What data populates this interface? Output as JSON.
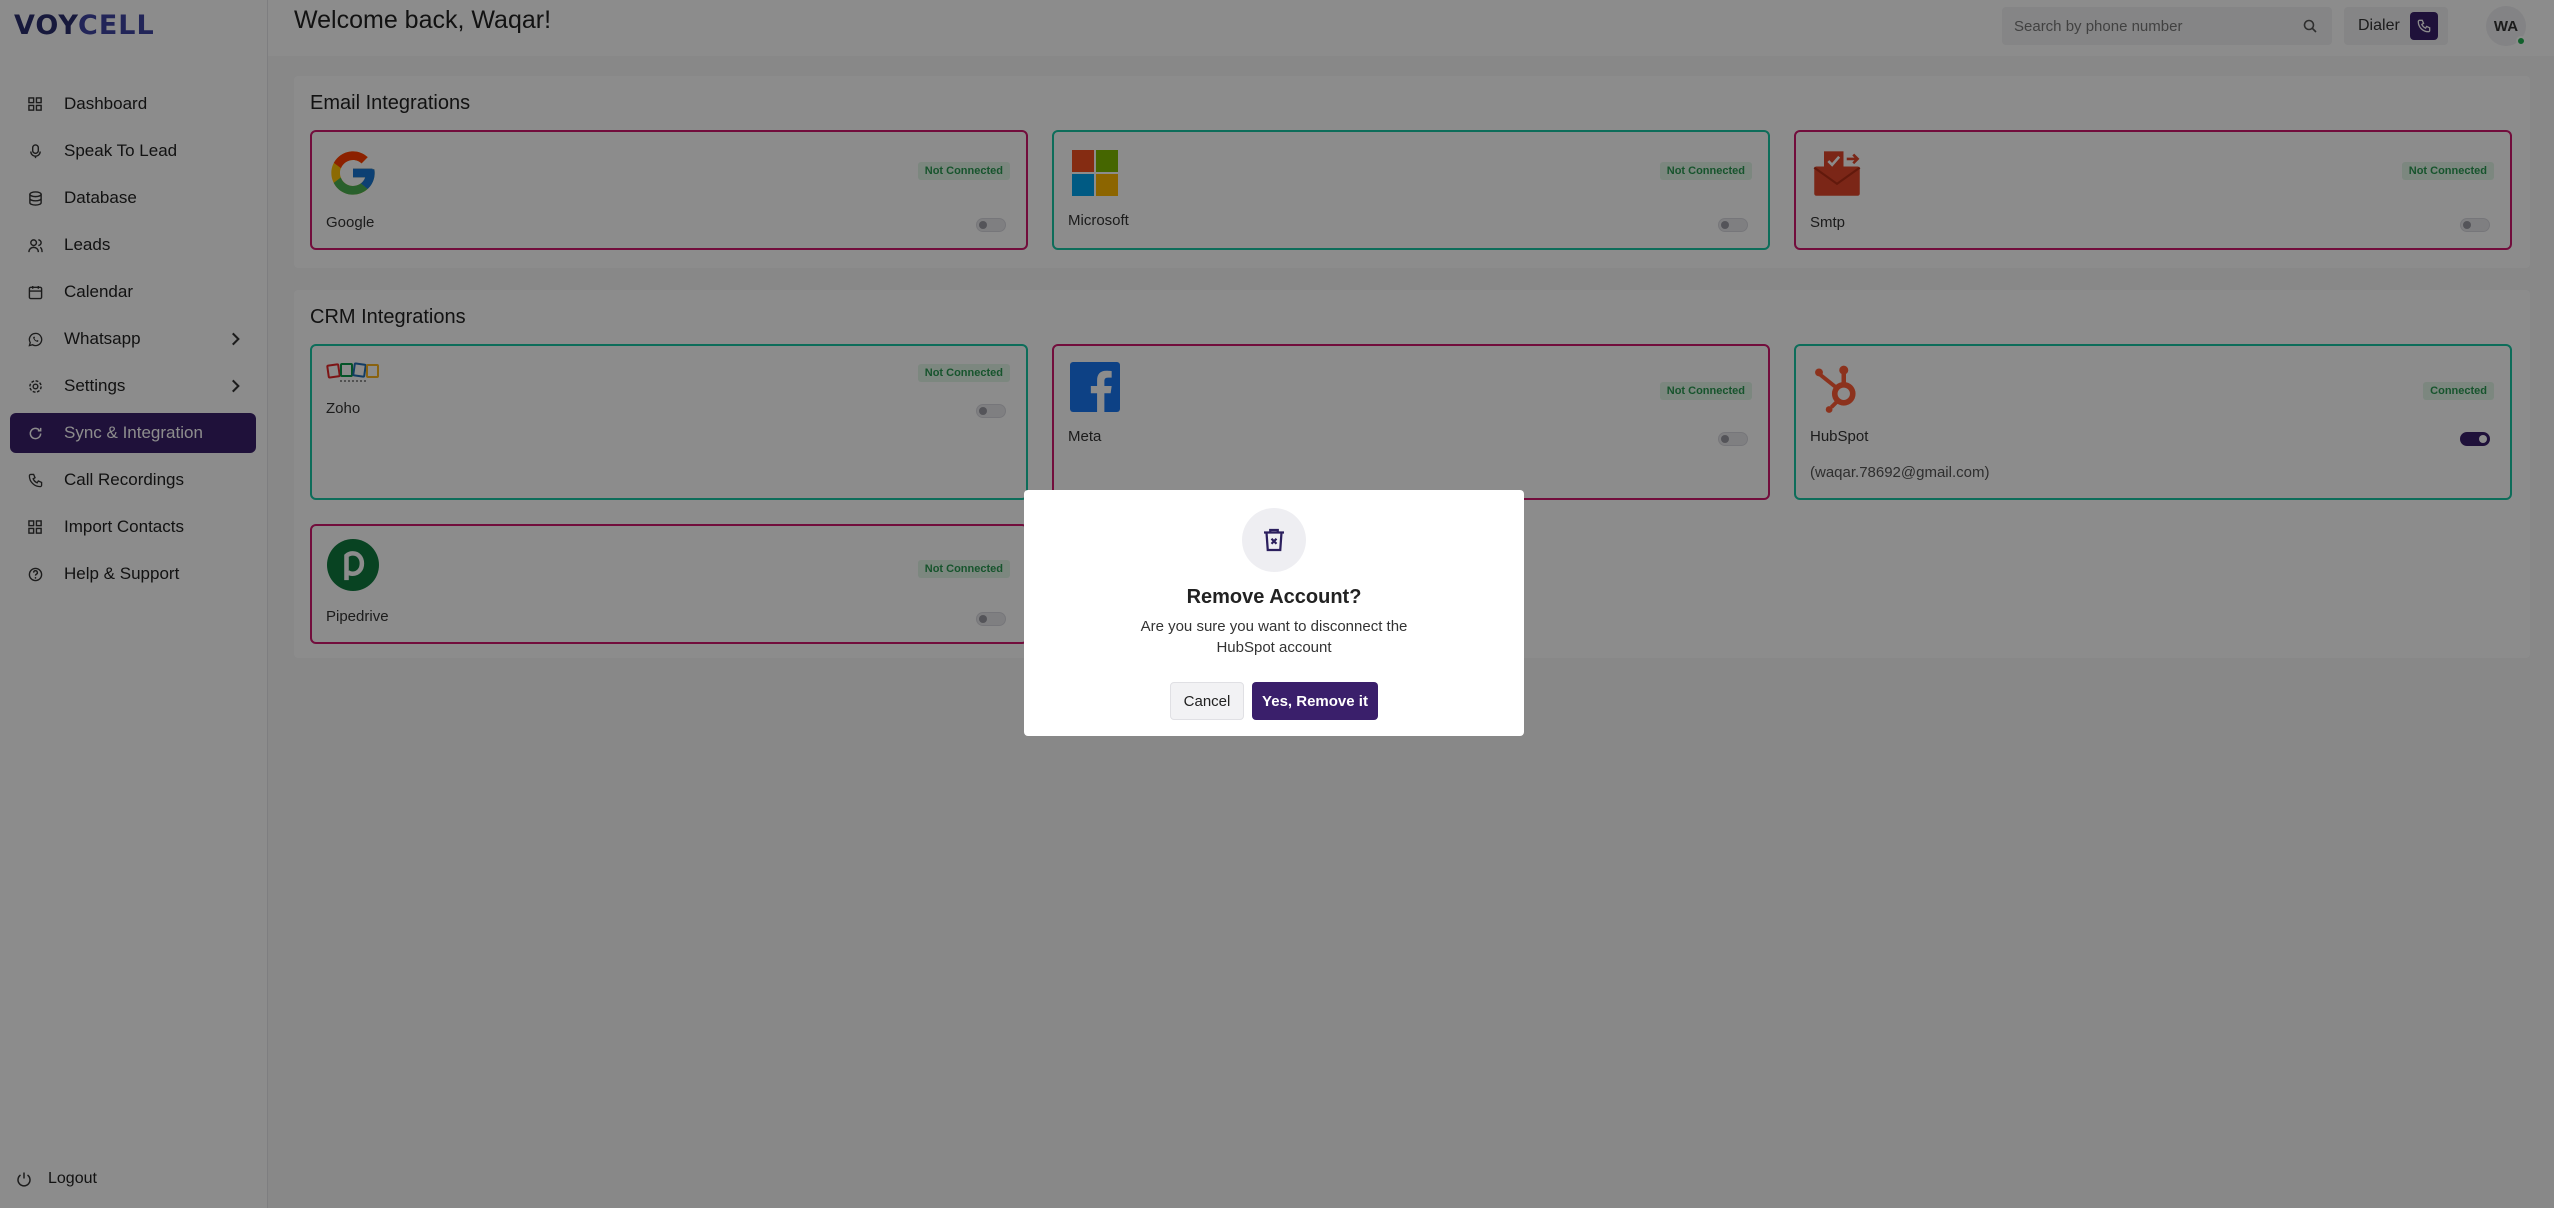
{
  "brand": {
    "part1": "VOY",
    "part2": "CELL"
  },
  "sidebar": {
    "items": [
      {
        "label": "Dashboard",
        "icon": "grid-icon"
      },
      {
        "label": "Speak To Lead",
        "icon": "mic-icon"
      },
      {
        "label": "Database",
        "icon": "database-icon"
      },
      {
        "label": "Leads",
        "icon": "users-icon"
      },
      {
        "label": "Calendar",
        "icon": "calendar-icon"
      },
      {
        "label": "Whatsapp",
        "icon": "whatsapp-icon"
      },
      {
        "label": "Settings",
        "icon": "gear-icon"
      },
      {
        "label": "Sync & Integration",
        "icon": "sync-icon"
      },
      {
        "label": "Call Recordings",
        "icon": "phone-icon"
      },
      {
        "label": "Import Contacts",
        "icon": "grid-icon"
      },
      {
        "label": "Help & Support",
        "icon": "help-icon"
      }
    ],
    "active": "Sync & Integration",
    "logout_label": "Logout"
  },
  "header": {
    "welcome": "Welcome back, Waqar!",
    "search_placeholder": "Search by phone number",
    "dialer_label": "Dialer",
    "avatar_initials": "WA"
  },
  "email_integrations": {
    "title": "Email Integrations",
    "cards": [
      {
        "name": "Google",
        "status": "Not Connected"
      },
      {
        "name": "Microsoft",
        "status": "Not Connected"
      },
      {
        "name": "Smtp",
        "status": "Not Connected"
      }
    ]
  },
  "crm_integrations": {
    "title": "CRM Integrations",
    "cards": [
      {
        "name": "Zoho",
        "status": "Not Connected"
      },
      {
        "name": "Meta",
        "status": "Not Connected"
      },
      {
        "name": "HubSpot",
        "status": "Connected",
        "email": "(waqar.78692@gmail.com)"
      },
      {
        "name": "Pipedrive",
        "status": "Not Connected"
      }
    ]
  },
  "modal": {
    "title": "Remove Account?",
    "body": "Are you sure you want to disconnect the HubSpot account",
    "cancel_label": "Cancel",
    "confirm_label": "Yes, Remove it"
  },
  "colors": {
    "accent": "#3a1f6b",
    "card_border_pink": "#d0186e",
    "card_border_teal": "#19c6a4",
    "connected_green": "#2a9a52"
  }
}
